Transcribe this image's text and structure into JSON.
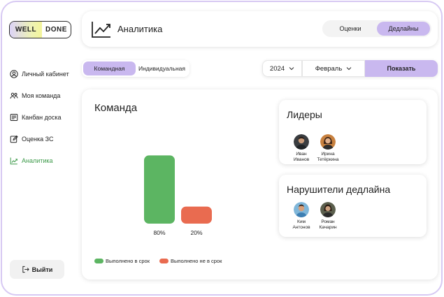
{
  "brand": {
    "part1": "WELL",
    "part2": "DONE"
  },
  "sidebar": {
    "items": [
      {
        "label": "Личный кабинет",
        "icon": "user-circle-icon",
        "active": false
      },
      {
        "label": "Моя команда",
        "icon": "team-icon",
        "active": false
      },
      {
        "label": "Канбан доска",
        "icon": "kanban-board-icon",
        "active": false
      },
      {
        "label": "Оценка ЗС",
        "icon": "edit-icon",
        "active": false
      },
      {
        "label": "Аналитика",
        "icon": "chart-line-icon",
        "active": true
      }
    ],
    "logout_label": "Выйти"
  },
  "header": {
    "title": "Аналитика",
    "tabs": [
      {
        "label": "Оценки",
        "active": false
      },
      {
        "label": "Дедлайны",
        "active": true
      }
    ]
  },
  "mode_toggle": {
    "options": [
      {
        "label": "Командная",
        "active": true
      },
      {
        "label": "Индивидуальная",
        "active": false
      }
    ]
  },
  "filters": {
    "year": "2024",
    "month": "Февраль",
    "show_label": "Показать"
  },
  "main": {
    "title": "Команда"
  },
  "chart_data": {
    "type": "bar",
    "categories": [
      "Выполнено в срок",
      "Выполнено не в срок"
    ],
    "values": [
      80,
      20
    ],
    "value_labels": [
      "80%",
      "20%"
    ],
    "colors": [
      "#5cb562",
      "#e96b50"
    ],
    "ylim": [
      0,
      100
    ],
    "legend": [
      "Выполнено в срок",
      "Выполнено не в срок"
    ],
    "legend_position": "bottom-left"
  },
  "leaders": {
    "title": "Лидеры",
    "people": [
      {
        "name": "Иван",
        "surname": "Иванов"
      },
      {
        "name": "Ирина",
        "surname": "Тетёркина"
      }
    ]
  },
  "violators": {
    "title": "Нарушители дедлайна",
    "people": [
      {
        "name": "Ким",
        "surname": "Антонов"
      },
      {
        "name": "Роман",
        "surname": "Качарин"
      }
    ]
  },
  "colors": {
    "accent": "#c9b8ef",
    "active_nav": "#3d9a4a",
    "frame_border": "#d7c9f3"
  }
}
